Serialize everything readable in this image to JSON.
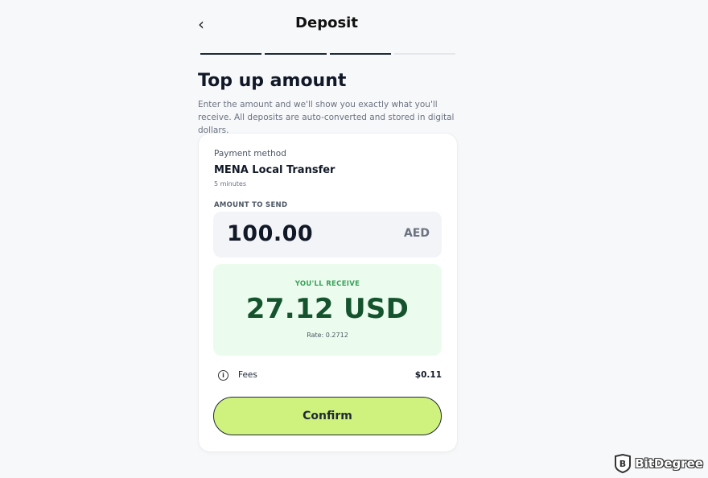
{
  "header": {
    "back_icon": "chevron-left-icon",
    "title": "Deposit"
  },
  "progress": {
    "total_steps": 4,
    "completed_steps": 3
  },
  "heading": "Top up amount",
  "description": "Enter the amount and we'll show you exactly what you'll receive. All deposits are auto-converted and stored in digital dollars.",
  "card": {
    "payment_method_label": "Payment method",
    "payment_method_name": "MENA Local Transfer",
    "payment_method_time": "5 minutes",
    "amount_label": "AMOUNT TO SEND",
    "amount_value": "100.00",
    "amount_currency": "AED",
    "receive_label": "YOU'LL RECEIVE",
    "receive_value": "27.12 USD",
    "rate_text": "Rate: 0.2712",
    "fees_icon": "info-icon",
    "fees_label": "Fees",
    "fees_value": "$0.11",
    "confirm_label": "Confirm"
  },
  "watermark": {
    "text": "BitDegree"
  },
  "colors": {
    "page_bg": "#f7f8fa",
    "accent_button": "#cff17e",
    "receive_bg": "#ebfcee",
    "receive_text": "#14532d",
    "receive_label": "#3aa05a"
  }
}
